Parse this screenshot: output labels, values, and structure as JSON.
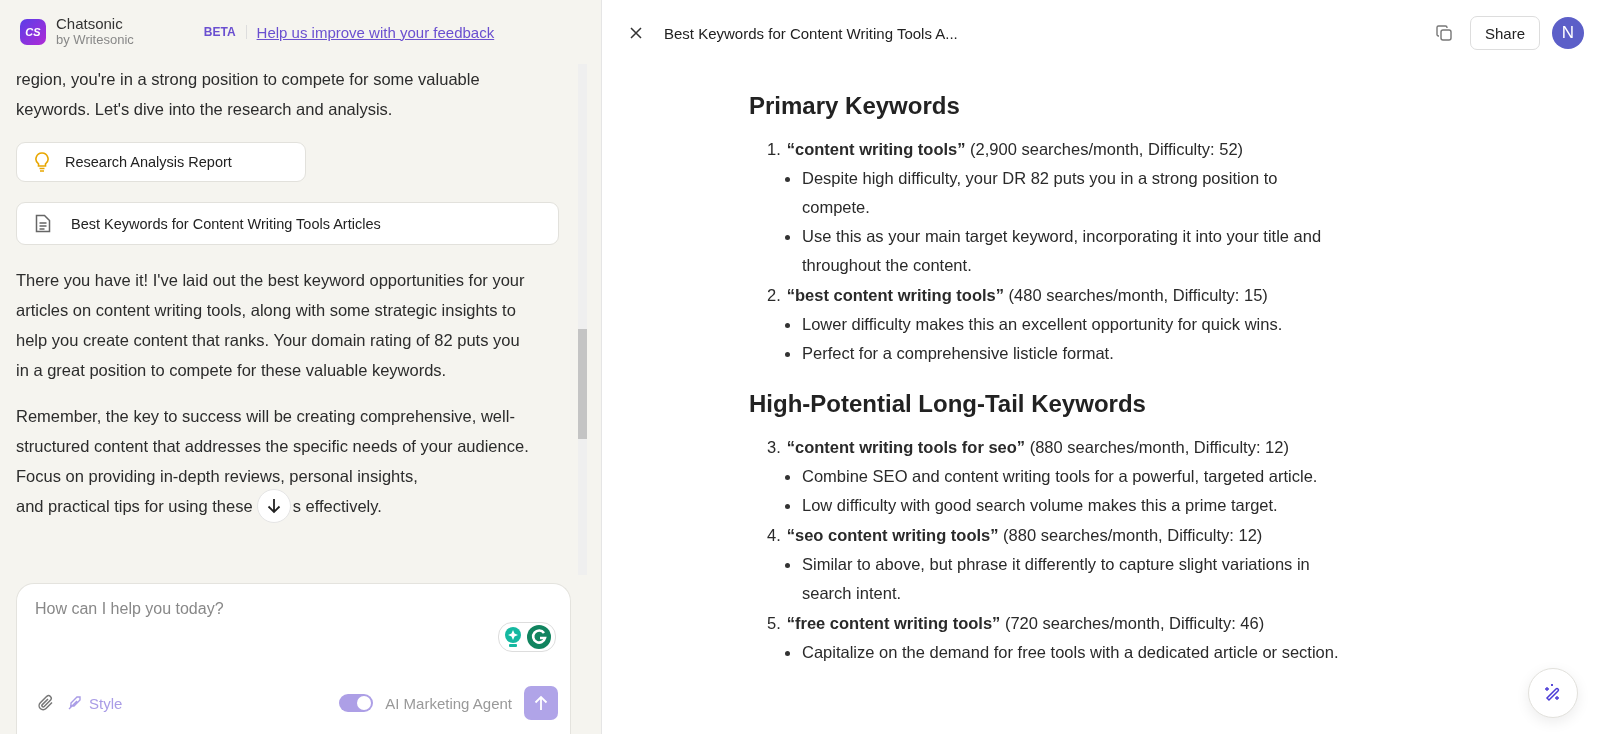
{
  "header": {
    "logo": "CS",
    "brand": "Chatsonic",
    "byline": "by Writesonic",
    "badge": "BETA",
    "feedback_link": "Help us improve with your feedback"
  },
  "chat": {
    "intro": "region, you're in a strong position to compete for some valuable keywords. Let's dive into the research and analysis.",
    "cards": [
      {
        "kind": "idea",
        "label": "Research Analysis Report"
      },
      {
        "kind": "document",
        "label": "Best Keywords for Content Writing Tools Articles"
      }
    ],
    "paragraph": "There you have it! I've laid out the best keyword opportunities for your articles on content writing tools, along with some strategic insights to help you create content that ranks. Your domain rating of 82 puts you in a great position to compete for these valuable keywords.",
    "last_paragraph": {
      "text": "Remember, the key to success will be creating comprehensive, well-structured content that addresses the specific needs of your audience. Focus on providing in-depth reviews, personal insights,",
      "last_line_start": "and practical tips for using these",
      "last_line_end": "s effectively."
    }
  },
  "composer": {
    "placeholder": "How can I help you today?",
    "style_label": "Style",
    "agent_toggle": {
      "label": "AI Marketing Agent",
      "on": true
    }
  },
  "document": {
    "title": "Best Keywords for Content Writing Tools A...",
    "share": "Share",
    "avatar": "N",
    "sections": [
      {
        "heading": "Primary Keywords",
        "items": [
          {
            "number": "1.",
            "keyword": "“content writing tools”",
            "detail": "(2,900 searches/month, Difficulty: 52)",
            "points": [
              "Despite high difficulty, your DR 82 puts you in a strong position to compete.",
              "Use this as your main target keyword, incorporating it into your title and throughout the content."
            ]
          },
          {
            "number": "2.",
            "keyword": "“best content writing tools”",
            "detail": "(480 searches/month, Difficulty: 15)",
            "points": [
              "Lower difficulty makes this an excellent opportunity for quick wins.",
              "Perfect for a comprehensive listicle format."
            ]
          }
        ]
      },
      {
        "heading": "High-Potential Long-Tail Keywords",
        "items": [
          {
            "number": "3.",
            "keyword": "“content writing tools for seo”",
            "detail": "(880 searches/month, Difficulty: 12)",
            "points": [
              "Combine SEO and content writing tools for a powerful, targeted article.",
              "Low difficulty with good search volume makes this a prime target."
            ]
          },
          {
            "number": "4.",
            "keyword": "“seo content writing tools”",
            "detail": "(880 searches/month, Difficulty: 12)",
            "points": [
              "Similar to above, but phrase it differently to capture slight variations in search intent."
            ]
          },
          {
            "number": "5.",
            "keyword": "“free content writing tools”",
            "detail": "(720 searches/month, Difficulty: 46)",
            "points": [
              "Capitalize on the demand for free tools with a dedicated article or section."
            ]
          }
        ]
      }
    ]
  }
}
